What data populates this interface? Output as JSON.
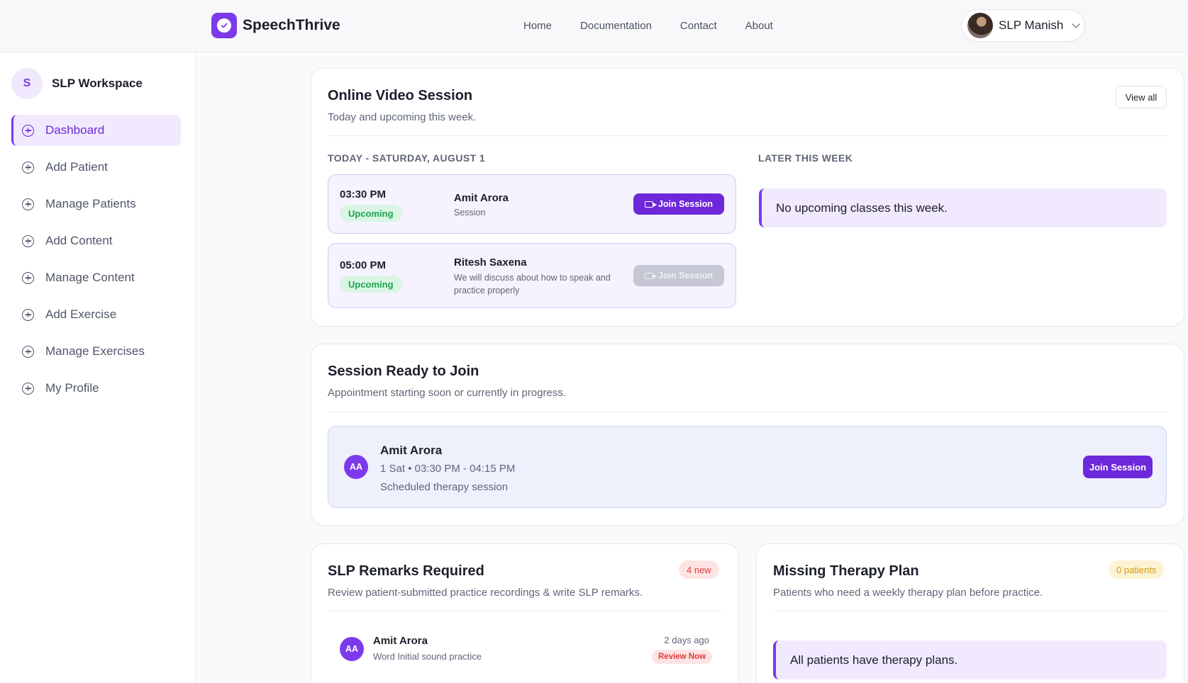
{
  "app": {
    "brand": "SpeechThrive",
    "nav": [
      "Home",
      "Documentation",
      "Contact",
      "About"
    ],
    "user": "SLP Manish"
  },
  "sidebar": {
    "workspace_initial": "S",
    "workspace_name": "SLP Workspace",
    "items": [
      {
        "label": "Dashboard",
        "active": true
      },
      {
        "label": "Add Patient"
      },
      {
        "label": "Manage Patients"
      },
      {
        "label": "Add Content"
      },
      {
        "label": "Manage Content"
      },
      {
        "label": "Add Exercise"
      },
      {
        "label": "Manage Exercises"
      },
      {
        "label": "My Profile"
      }
    ]
  },
  "video_session": {
    "title": "Online Video Session",
    "subtitle": "Today and upcoming this week.",
    "view_all": "View all",
    "today_label": "TODAY - SATURDAY, AUGUST 1",
    "later_label": "LATER THIS WEEK",
    "sessions": [
      {
        "time": "03:30 PM",
        "status": "Upcoming",
        "name": "Amit Arora",
        "desc": "Session",
        "button": "Join Session",
        "enabled": true
      },
      {
        "time": "05:00 PM",
        "status": "Upcoming",
        "name": "Ritesh Saxena",
        "desc": "We will discuss about how to speak and practice properly",
        "button": "Join Session",
        "enabled": false
      }
    ],
    "later_empty": "No upcoming classes this week."
  },
  "ready": {
    "title": "Session Ready to Join",
    "subtitle": "Appointment starting soon or currently in progress.",
    "initials": "AA",
    "name": "Amit Arora",
    "time": "1 Sat • 03:30 PM - 04:15 PM",
    "desc": "Scheduled therapy session",
    "button": "Join Session"
  },
  "remarks": {
    "title": "SLP Remarks Required",
    "badge": "4 new",
    "subtitle": "Review patient-submitted practice recordings & write SLP remarks.",
    "item": {
      "initials": "AA",
      "name": "Amit Arora",
      "desc": "Word Initial sound practice",
      "ago": "2 days ago",
      "action": "Review Now"
    }
  },
  "therapy": {
    "title": "Missing Therapy Plan",
    "badge": "0 patients",
    "subtitle": "Patients who need a weekly therapy plan before practice.",
    "empty": "All patients have therapy plans."
  },
  "colors": {
    "accent": "#7c3aed",
    "success": "#22a352",
    "danger": "#e03a3a",
    "warning": "#d69a0c"
  }
}
